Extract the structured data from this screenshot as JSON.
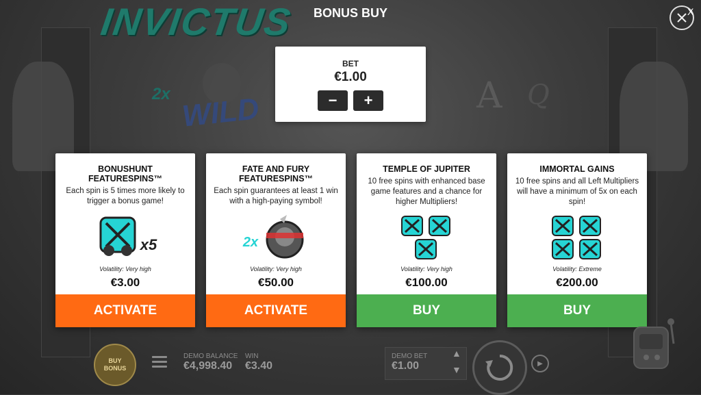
{
  "game": {
    "logo_text": "INVICTUS",
    "wild_label": "WILD",
    "wild_multiplier": "2x",
    "bg_symbol_a": "A",
    "bg_symbol_q": "Q"
  },
  "header": {
    "title": "BONUS BUY",
    "close_icon": "close-icon",
    "close_label": "X"
  },
  "bet": {
    "label": "BET",
    "value": "€1.00",
    "minus_label": "−",
    "plus_label": "+"
  },
  "cards": [
    {
      "title_line1": "BONUSHUNT",
      "title_line2": "FEATURESPINS™",
      "description": "Each spin is 5 times more likely to trigger a bonus game!",
      "art_label": "x5",
      "volatility": "Volatility: Very high",
      "price": "€3.00",
      "button_label": "ACTIVATE",
      "button_color": "#ff6a13"
    },
    {
      "title_line1": "FATE AND FURY",
      "title_line2": "FEATURESPINS™",
      "description": "Each spin guarantees at least 1 win with a high-paying symbol!",
      "art_label": "2x",
      "volatility": "Volatility: Very high",
      "price": "€50.00",
      "button_label": "ACTIVATE",
      "button_color": "#ff6a13"
    },
    {
      "title_line1": "TEMPLE OF JUPITER",
      "title_line2": "",
      "description": "10 free spins with enhanced base game features and a chance for higher Multipliers!",
      "volatility": "Volatility: Very high",
      "price": "€100.00",
      "button_label": "BUY",
      "button_color": "#4caf50"
    },
    {
      "title_line1": "IMMORTAL GAINS",
      "title_line2": "",
      "description": "10 free spins and all Left Multipliers will have a minimum of 5x on each spin!",
      "volatility": "Volatility: Extreme",
      "price": "€200.00",
      "button_label": "BUY",
      "button_color": "#4caf50"
    }
  ],
  "bottom": {
    "buy_bonus_line1": "BUY",
    "buy_bonus_line2": "BONUS",
    "demo_balance_label": "DEMO BALANCE",
    "demo_balance_value": "€4,998.40",
    "win_label": "WIN",
    "win_value": "€3.40",
    "demo_bet_label": "DEMO BET",
    "demo_bet_value": "€1.00"
  },
  "colors": {
    "accent_orange": "#ff6a13",
    "accent_green": "#4caf50",
    "logo_teal": "#1f7a6b",
    "scatter_cyan": "#26d4d4"
  }
}
